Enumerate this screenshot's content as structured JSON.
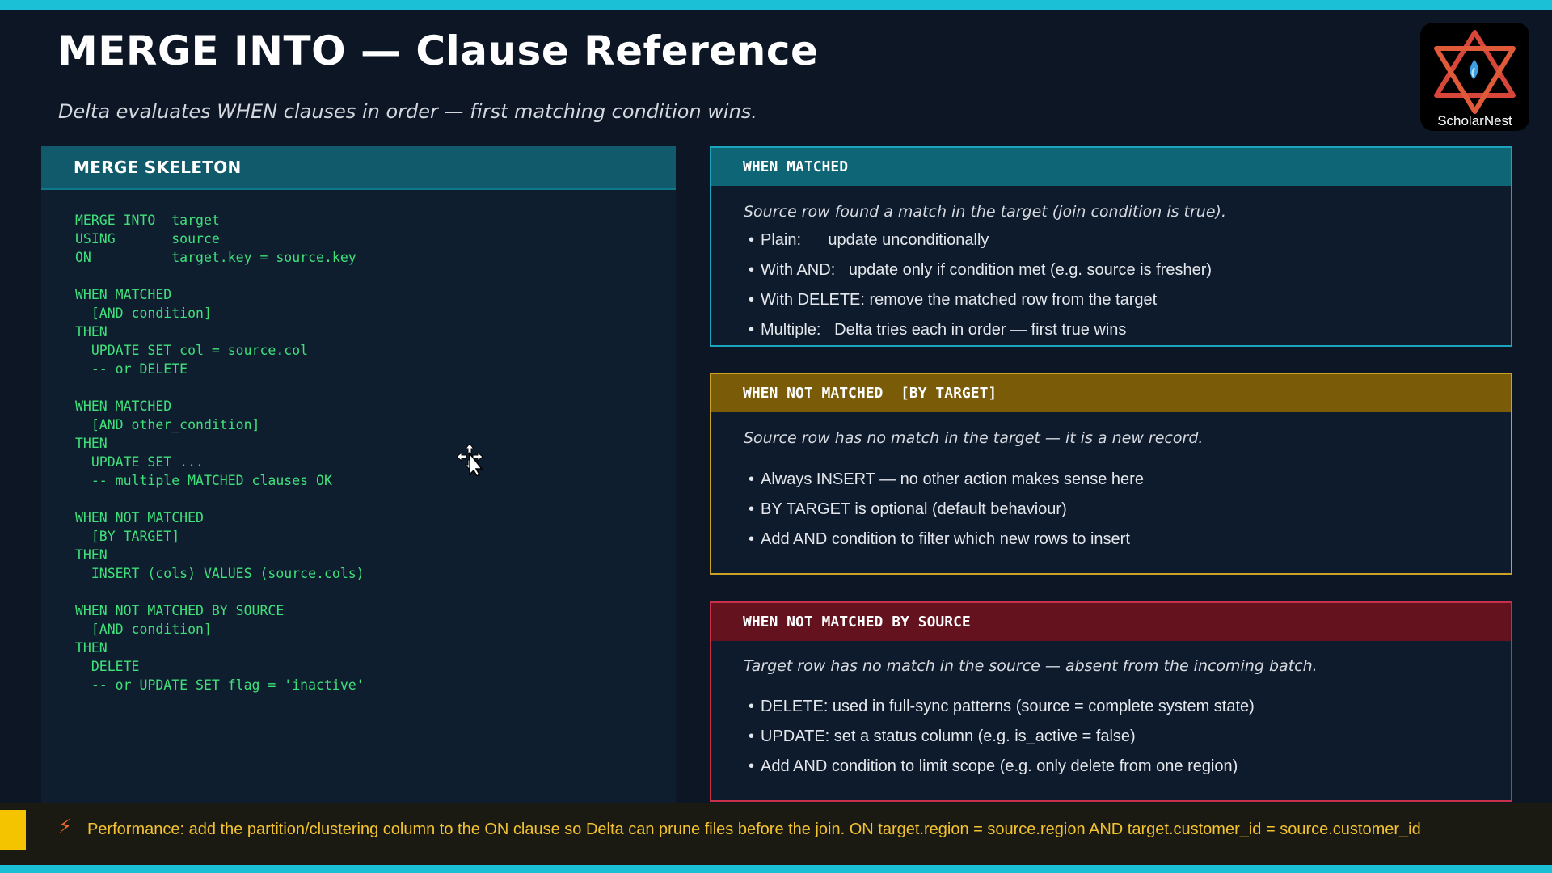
{
  "slide": {
    "title": "MERGE INTO — Clause Reference",
    "subtitle": "Delta evaluates WHEN clauses in order — first matching condition wins."
  },
  "logo": {
    "text": "ScholarNest",
    "icon": "star-of-david-icon"
  },
  "skeleton": {
    "header": "MERGE SKELETON",
    "code_lines": [
      "MERGE INTO  target",
      "USING       source",
      "ON          target.key = source.key",
      "",
      "WHEN MATCHED",
      "  [AND condition]",
      "THEN",
      "  UPDATE SET col = source.col",
      "  -- or DELETE",
      "",
      "WHEN MATCHED",
      "  [AND other_condition]",
      "THEN",
      "  UPDATE SET ...",
      "  -- multiple MATCHED clauses OK",
      "",
      "WHEN NOT MATCHED",
      "  [BY TARGET]",
      "THEN",
      "  INSERT (cols) VALUES (source.cols)",
      "",
      "WHEN NOT MATCHED BY SOURCE",
      "  [AND condition]",
      "THEN",
      "  DELETE",
      "  -- or UPDATE SET flag = 'inactive'"
    ]
  },
  "cards": {
    "matched": {
      "header": "WHEN MATCHED",
      "lead": "Source row found a match in the target (join condition is true).",
      "bullets": [
        "Plain:      update unconditionally",
        "With AND:   update only if condition met (e.g. source is fresher)",
        "With DELETE: remove the matched row from the target",
        "Multiple:   Delta tries each in order — first true wins"
      ],
      "accent": "#1aa5bd"
    },
    "not_matched": {
      "header": "WHEN NOT MATCHED  [BY TARGET]",
      "lead": "Source row has no match in the target — it is a new record.",
      "bullets": [
        "Always INSERT — no other action makes sense here",
        "BY TARGET is optional (default behaviour)",
        "Add AND condition to filter which new rows to insert"
      ],
      "accent": "#c9a227"
    },
    "by_source": {
      "header": "WHEN NOT MATCHED BY SOURCE",
      "lead": "Target row has no match in the source — absent from the incoming batch.",
      "bullets": [
        "DELETE: used in full-sync patterns (source = complete system state)",
        "UPDATE: set a status column (e.g. is_active = false)",
        "Add AND condition to limit scope (e.g. only delete from one region)"
      ],
      "accent": "#c8304a"
    }
  },
  "tip": {
    "icon": "lightning-icon",
    "text": "Performance: add the partition/clustering column to the ON clause so Delta can prune files before the join.  ON target.region = source.region AND target.customer_id = source.customer_id"
  }
}
